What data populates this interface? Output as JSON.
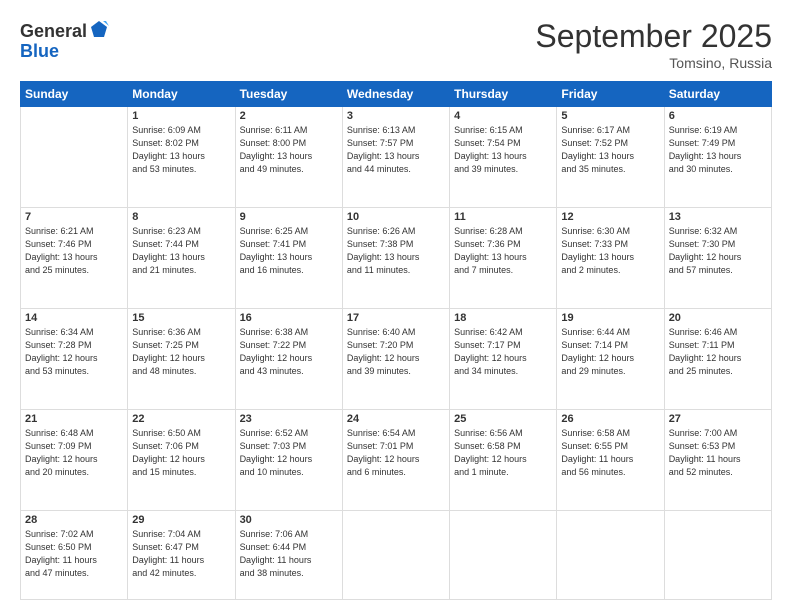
{
  "header": {
    "logo_line1": "General",
    "logo_line2": "Blue",
    "month": "September 2025",
    "location": "Tomsino, Russia"
  },
  "weekdays": [
    "Sunday",
    "Monday",
    "Tuesday",
    "Wednesday",
    "Thursday",
    "Friday",
    "Saturday"
  ],
  "weeks": [
    [
      {
        "day": "",
        "info": ""
      },
      {
        "day": "1",
        "info": "Sunrise: 6:09 AM\nSunset: 8:02 PM\nDaylight: 13 hours\nand 53 minutes."
      },
      {
        "day": "2",
        "info": "Sunrise: 6:11 AM\nSunset: 8:00 PM\nDaylight: 13 hours\nand 49 minutes."
      },
      {
        "day": "3",
        "info": "Sunrise: 6:13 AM\nSunset: 7:57 PM\nDaylight: 13 hours\nand 44 minutes."
      },
      {
        "day": "4",
        "info": "Sunrise: 6:15 AM\nSunset: 7:54 PM\nDaylight: 13 hours\nand 39 minutes."
      },
      {
        "day": "5",
        "info": "Sunrise: 6:17 AM\nSunset: 7:52 PM\nDaylight: 13 hours\nand 35 minutes."
      },
      {
        "day": "6",
        "info": "Sunrise: 6:19 AM\nSunset: 7:49 PM\nDaylight: 13 hours\nand 30 minutes."
      }
    ],
    [
      {
        "day": "7",
        "info": "Sunrise: 6:21 AM\nSunset: 7:46 PM\nDaylight: 13 hours\nand 25 minutes."
      },
      {
        "day": "8",
        "info": "Sunrise: 6:23 AM\nSunset: 7:44 PM\nDaylight: 13 hours\nand 21 minutes."
      },
      {
        "day": "9",
        "info": "Sunrise: 6:25 AM\nSunset: 7:41 PM\nDaylight: 13 hours\nand 16 minutes."
      },
      {
        "day": "10",
        "info": "Sunrise: 6:26 AM\nSunset: 7:38 PM\nDaylight: 13 hours\nand 11 minutes."
      },
      {
        "day": "11",
        "info": "Sunrise: 6:28 AM\nSunset: 7:36 PM\nDaylight: 13 hours\nand 7 minutes."
      },
      {
        "day": "12",
        "info": "Sunrise: 6:30 AM\nSunset: 7:33 PM\nDaylight: 13 hours\nand 2 minutes."
      },
      {
        "day": "13",
        "info": "Sunrise: 6:32 AM\nSunset: 7:30 PM\nDaylight: 12 hours\nand 57 minutes."
      }
    ],
    [
      {
        "day": "14",
        "info": "Sunrise: 6:34 AM\nSunset: 7:28 PM\nDaylight: 12 hours\nand 53 minutes."
      },
      {
        "day": "15",
        "info": "Sunrise: 6:36 AM\nSunset: 7:25 PM\nDaylight: 12 hours\nand 48 minutes."
      },
      {
        "day": "16",
        "info": "Sunrise: 6:38 AM\nSunset: 7:22 PM\nDaylight: 12 hours\nand 43 minutes."
      },
      {
        "day": "17",
        "info": "Sunrise: 6:40 AM\nSunset: 7:20 PM\nDaylight: 12 hours\nand 39 minutes."
      },
      {
        "day": "18",
        "info": "Sunrise: 6:42 AM\nSunset: 7:17 PM\nDaylight: 12 hours\nand 34 minutes."
      },
      {
        "day": "19",
        "info": "Sunrise: 6:44 AM\nSunset: 7:14 PM\nDaylight: 12 hours\nand 29 minutes."
      },
      {
        "day": "20",
        "info": "Sunrise: 6:46 AM\nSunset: 7:11 PM\nDaylight: 12 hours\nand 25 minutes."
      }
    ],
    [
      {
        "day": "21",
        "info": "Sunrise: 6:48 AM\nSunset: 7:09 PM\nDaylight: 12 hours\nand 20 minutes."
      },
      {
        "day": "22",
        "info": "Sunrise: 6:50 AM\nSunset: 7:06 PM\nDaylight: 12 hours\nand 15 minutes."
      },
      {
        "day": "23",
        "info": "Sunrise: 6:52 AM\nSunset: 7:03 PM\nDaylight: 12 hours\nand 10 minutes."
      },
      {
        "day": "24",
        "info": "Sunrise: 6:54 AM\nSunset: 7:01 PM\nDaylight: 12 hours\nand 6 minutes."
      },
      {
        "day": "25",
        "info": "Sunrise: 6:56 AM\nSunset: 6:58 PM\nDaylight: 12 hours\nand 1 minute."
      },
      {
        "day": "26",
        "info": "Sunrise: 6:58 AM\nSunset: 6:55 PM\nDaylight: 11 hours\nand 56 minutes."
      },
      {
        "day": "27",
        "info": "Sunrise: 7:00 AM\nSunset: 6:53 PM\nDaylight: 11 hours\nand 52 minutes."
      }
    ],
    [
      {
        "day": "28",
        "info": "Sunrise: 7:02 AM\nSunset: 6:50 PM\nDaylight: 11 hours\nand 47 minutes."
      },
      {
        "day": "29",
        "info": "Sunrise: 7:04 AM\nSunset: 6:47 PM\nDaylight: 11 hours\nand 42 minutes."
      },
      {
        "day": "30",
        "info": "Sunrise: 7:06 AM\nSunset: 6:44 PM\nDaylight: 11 hours\nand 38 minutes."
      },
      {
        "day": "",
        "info": ""
      },
      {
        "day": "",
        "info": ""
      },
      {
        "day": "",
        "info": ""
      },
      {
        "day": "",
        "info": ""
      }
    ]
  ]
}
